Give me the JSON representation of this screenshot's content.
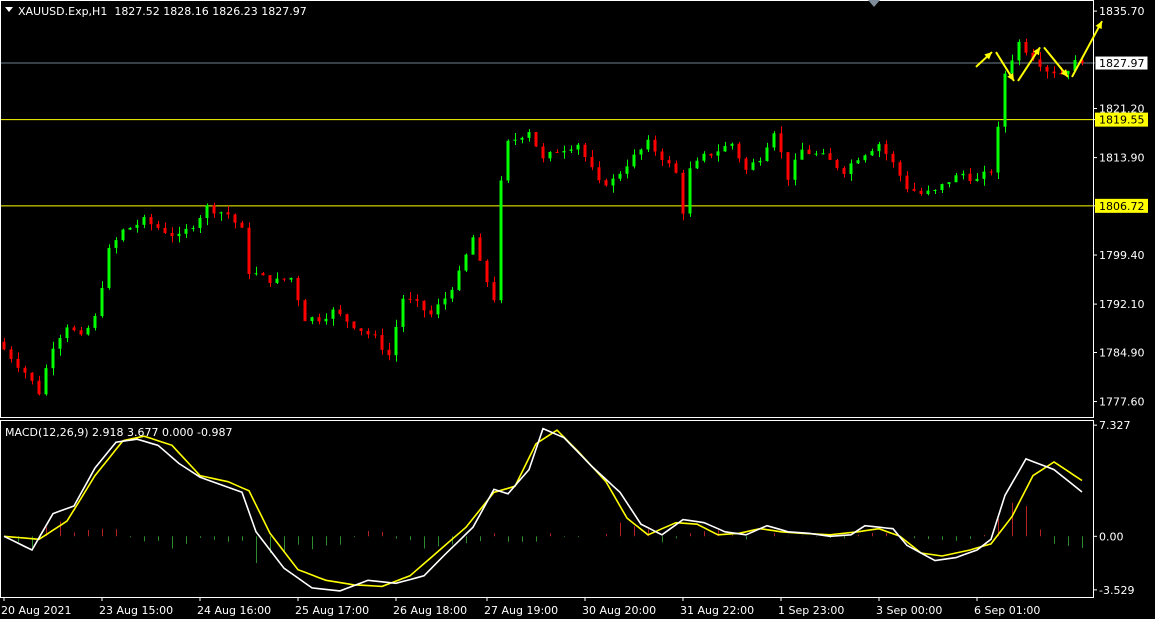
{
  "colors": {
    "background": "#000000",
    "frame": "#ffffff",
    "bull": "#00ff00",
    "bear": "#ff0000",
    "level_line": "#ffff00",
    "bid_line": "#708090",
    "projection": "#ffff00",
    "macd_line": "#ffffff",
    "signal_line": "#ffff00",
    "hist_pos": "#b22222",
    "hist_neg": "#2e8b2e"
  },
  "symbol_header": "XAUUSD.Exp,H1  1827.52 1828.16 1826.23 1827.97",
  "macd_header": "MACD(12,26,9) 2.918 3.677 0.000 -0.987",
  "chart_data": [
    {
      "type": "candlestick",
      "title": "XAUUSD.Exp,H1",
      "ohlc": [
        1827.52,
        1828.16,
        1826.23,
        1827.97
      ],
      "y_ticks": [
        "1835.70",
        "1827.97",
        "1821.20",
        "1819.55",
        "1813.90",
        "1806.72",
        "1799.40",
        "1792.10",
        "1784.90",
        "1777.60"
      ],
      "ylim": [
        1775.3,
        1837.2
      ],
      "current_price": "1827.97",
      "horizontal_levels": [
        "1819.55",
        "1806.72"
      ],
      "grid": false,
      "x_ticks": [
        "20 Aug 2021",
        "23 Aug 15:00",
        "24 Aug 16:00",
        "25 Aug 17:00",
        "26 Aug 18:00",
        "27 Aug 19:00",
        "30 Aug 20:00",
        "31 Aug 22:00",
        "1 Sep 23:00",
        "3 Sep 00:00",
        "6 Sep 01:00"
      ],
      "price_path": [
        [
          0,
          1786.5
        ],
        [
          4,
          1782
        ],
        [
          6,
          1779
        ],
        [
          8,
          1786
        ],
        [
          10,
          1789
        ],
        [
          12,
          1787
        ],
        [
          14,
          1790
        ],
        [
          16,
          1800
        ],
        [
          18,
          1803
        ],
        [
          21,
          1804.5
        ],
        [
          24,
          1803
        ],
        [
          26,
          1802
        ],
        [
          28,
          1804
        ],
        [
          30,
          1806.5
        ],
        [
          33,
          1805.5
        ],
        [
          35,
          1803
        ],
        [
          36,
          1797
        ],
        [
          38,
          1796
        ],
        [
          40,
          1795.5
        ],
        [
          42,
          1796
        ],
        [
          44,
          1790
        ],
        [
          46,
          1790
        ],
        [
          48,
          1791
        ],
        [
          51,
          1789
        ],
        [
          54,
          1787
        ],
        [
          56,
          1784.5
        ],
        [
          58,
          1793
        ],
        [
          60,
          1792
        ],
        [
          62,
          1790.5
        ],
        [
          64,
          1793
        ],
        [
          66,
          1796.5
        ],
        [
          68,
          1802
        ],
        [
          69,
          1798
        ],
        [
          71,
          1793
        ],
        [
          72,
          1810
        ],
        [
          73,
          1816
        ],
        [
          76,
          1818
        ],
        [
          78,
          1813.5
        ],
        [
          80,
          1815
        ],
        [
          83,
          1816
        ],
        [
          85,
          1812
        ],
        [
          86,
          1810
        ],
        [
          88,
          1810.5
        ],
        [
          90,
          1813
        ],
        [
          93,
          1816
        ],
        [
          95,
          1814
        ],
        [
          97,
          1811.5
        ],
        [
          98,
          1806
        ],
        [
          99,
          1812
        ],
        [
          101,
          1814
        ],
        [
          103,
          1815
        ],
        [
          105,
          1816
        ],
        [
          107,
          1812
        ],
        [
          109,
          1814
        ],
        [
          111,
          1818
        ],
        [
          113,
          1811
        ],
        [
          115,
          1815
        ],
        [
          118,
          1814
        ],
        [
          121,
          1812
        ],
        [
          123,
          1814
        ],
        [
          126,
          1816
        ],
        [
          128,
          1813
        ],
        [
          130,
          1809.5
        ],
        [
          132,
          1808.5
        ],
        [
          134,
          1808.8
        ],
        [
          136,
          1810.5
        ],
        [
          138,
          1811.5
        ],
        [
          140,
          1810.5
        ],
        [
          142,
          1812
        ],
        [
          143,
          1818
        ],
        [
          144,
          1826.5
        ],
        [
          146,
          1831
        ],
        [
          148,
          1829
        ],
        [
          150,
          1827
        ],
        [
          152,
          1826.5
        ],
        [
          154,
          1827.97
        ]
      ],
      "projection": [
        [
          1827.4,
          1829.6
        ],
        [
          1829.6,
          1825.3
        ],
        [
          1825.3,
          1830.3
        ],
        [
          1830.3,
          1825.9
        ],
        [
          1825.9,
          1834.2
        ]
      ]
    },
    {
      "type": "line",
      "title": "MACD(12,26,9)",
      "values": {
        "macd": 2.918,
        "signal": 3.677,
        "level": 0.0,
        "histogram": -0.987
      },
      "y_ticks": [
        "7.327",
        "0.00",
        "-3.529"
      ],
      "ylim": [
        -4.0,
        7.6
      ],
      "series": [
        {
          "name": "MACD",
          "points": [
            [
              0,
              0.0
            ],
            [
              4,
              -0.9
            ],
            [
              7,
              1.5
            ],
            [
              10,
              2.0
            ],
            [
              13,
              4.5
            ],
            [
              16,
              6.2
            ],
            [
              19,
              6.4
            ],
            [
              22,
              6.0
            ],
            [
              25,
              4.8
            ],
            [
              28,
              3.9
            ],
            [
              31,
              3.4
            ],
            [
              34,
              2.9
            ],
            [
              36,
              0.3
            ],
            [
              40,
              -2.1
            ],
            [
              44,
              -3.4
            ],
            [
              48,
              -3.6
            ],
            [
              52,
              -2.9
            ],
            [
              56,
              -3.1
            ],
            [
              60,
              -2.6
            ],
            [
              63,
              -1.2
            ],
            [
              67,
              0.6
            ],
            [
              70,
              3.1
            ],
            [
              72,
              2.8
            ],
            [
              75,
              4.4
            ],
            [
              77,
              7.1
            ],
            [
              80,
              6.5
            ],
            [
              84,
              4.6
            ],
            [
              88,
              2.9
            ],
            [
              91,
              0.8
            ],
            [
              94,
              0.1
            ],
            [
              97,
              1.1
            ],
            [
              100,
              0.9
            ],
            [
              103,
              0.3
            ],
            [
              106,
              0.1
            ],
            [
              109,
              0.7
            ],
            [
              112,
              0.3
            ],
            [
              115,
              0.2
            ],
            [
              118,
              0.0
            ],
            [
              121,
              0.1
            ],
            [
              123,
              0.7
            ],
            [
              127,
              0.5
            ],
            [
              129,
              -0.6
            ],
            [
              133,
              -1.6
            ],
            [
              136,
              -1.4
            ],
            [
              139,
              -0.9
            ],
            [
              141,
              -0.2
            ],
            [
              143,
              2.7
            ],
            [
              146,
              5.1
            ],
            [
              150,
              4.4
            ],
            [
              154,
              2.918
            ]
          ]
        },
        {
          "name": "Signal",
          "points": [
            [
              0,
              0.0
            ],
            [
              5,
              -0.2
            ],
            [
              9,
              1.0
            ],
            [
              13,
              4.0
            ],
            [
              17,
              6.3
            ],
            [
              20,
              6.6
            ],
            [
              24,
              6.0
            ],
            [
              28,
              4.0
            ],
            [
              32,
              3.6
            ],
            [
              35,
              3.0
            ],
            [
              38,
              0.2
            ],
            [
              42,
              -2.2
            ],
            [
              46,
              -2.9
            ],
            [
              50,
              -3.2
            ],
            [
              54,
              -3.3
            ],
            [
              58,
              -2.6
            ],
            [
              62,
              -1.0
            ],
            [
              66,
              0.6
            ],
            [
              70,
              2.9
            ],
            [
              73,
              3.3
            ],
            [
              76,
              6.1
            ],
            [
              79,
              7.0
            ],
            [
              82,
              5.6
            ],
            [
              86,
              3.6
            ],
            [
              89,
              1.2
            ],
            [
              92,
              0.1
            ],
            [
              96,
              0.9
            ],
            [
              99,
              0.8
            ],
            [
              102,
              0.1
            ],
            [
              105,
              0.2
            ],
            [
              108,
              0.5
            ],
            [
              111,
              0.3
            ],
            [
              114,
              0.2
            ],
            [
              118,
              0.1
            ],
            [
              122,
              0.3
            ],
            [
              125,
              0.5
            ],
            [
              128,
              0.0
            ],
            [
              131,
              -1.1
            ],
            [
              134,
              -1.3
            ],
            [
              138,
              -0.9
            ],
            [
              141,
              -0.5
            ],
            [
              144,
              1.3
            ],
            [
              147,
              4.0
            ],
            [
              150,
              4.9
            ],
            [
              154,
              3.677
            ]
          ]
        }
      ]
    }
  ]
}
